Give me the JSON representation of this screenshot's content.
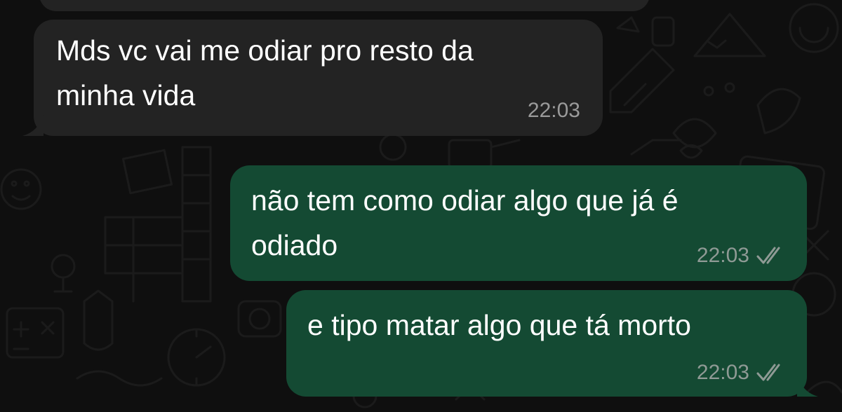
{
  "messages": [
    {
      "direction": "incoming",
      "lines": [
        "Mds vc vai me odiar pro resto da",
        "minha vida"
      ],
      "time": "22:03"
    },
    {
      "direction": "outgoing",
      "lines": [
        "não tem como odiar algo que já é",
        "odiado"
      ],
      "time": "22:03",
      "status": "read-double-check-icon"
    },
    {
      "direction": "outgoing",
      "lines": [
        "e tipo matar algo que tá morto"
      ],
      "time": "22:03",
      "status": "read-double-check-icon"
    }
  ],
  "colors": {
    "incoming_bubble": "#232323",
    "outgoing_bubble": "#144a33",
    "background": "#0f0f0f",
    "timestamp": "#9a9a9a",
    "tick": "#8f9a95"
  }
}
